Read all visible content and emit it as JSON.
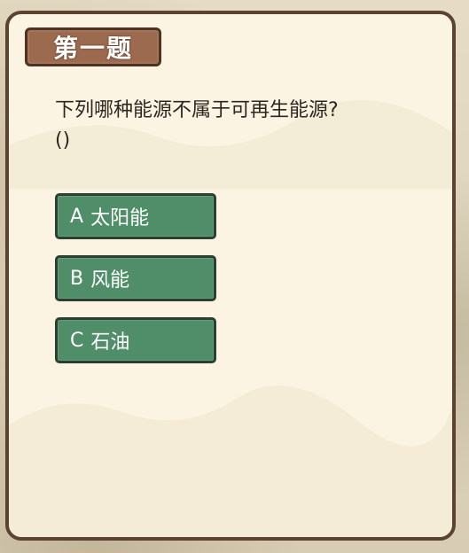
{
  "quiz": {
    "title": "第一题",
    "question": "下列哪种能源不属于可再生能源?",
    "blank": "()",
    "options": [
      {
        "letter": "A",
        "text": "太阳能"
      },
      {
        "letter": "B",
        "text": "风能"
      },
      {
        "letter": "C",
        "text": "石油"
      }
    ]
  },
  "colors": {
    "card_background": "#fbf4e2",
    "card_border": "#5a4330",
    "title_tag": "#9c6a4e",
    "option_button": "#4f8e68",
    "option_border": "#2c3f30"
  }
}
